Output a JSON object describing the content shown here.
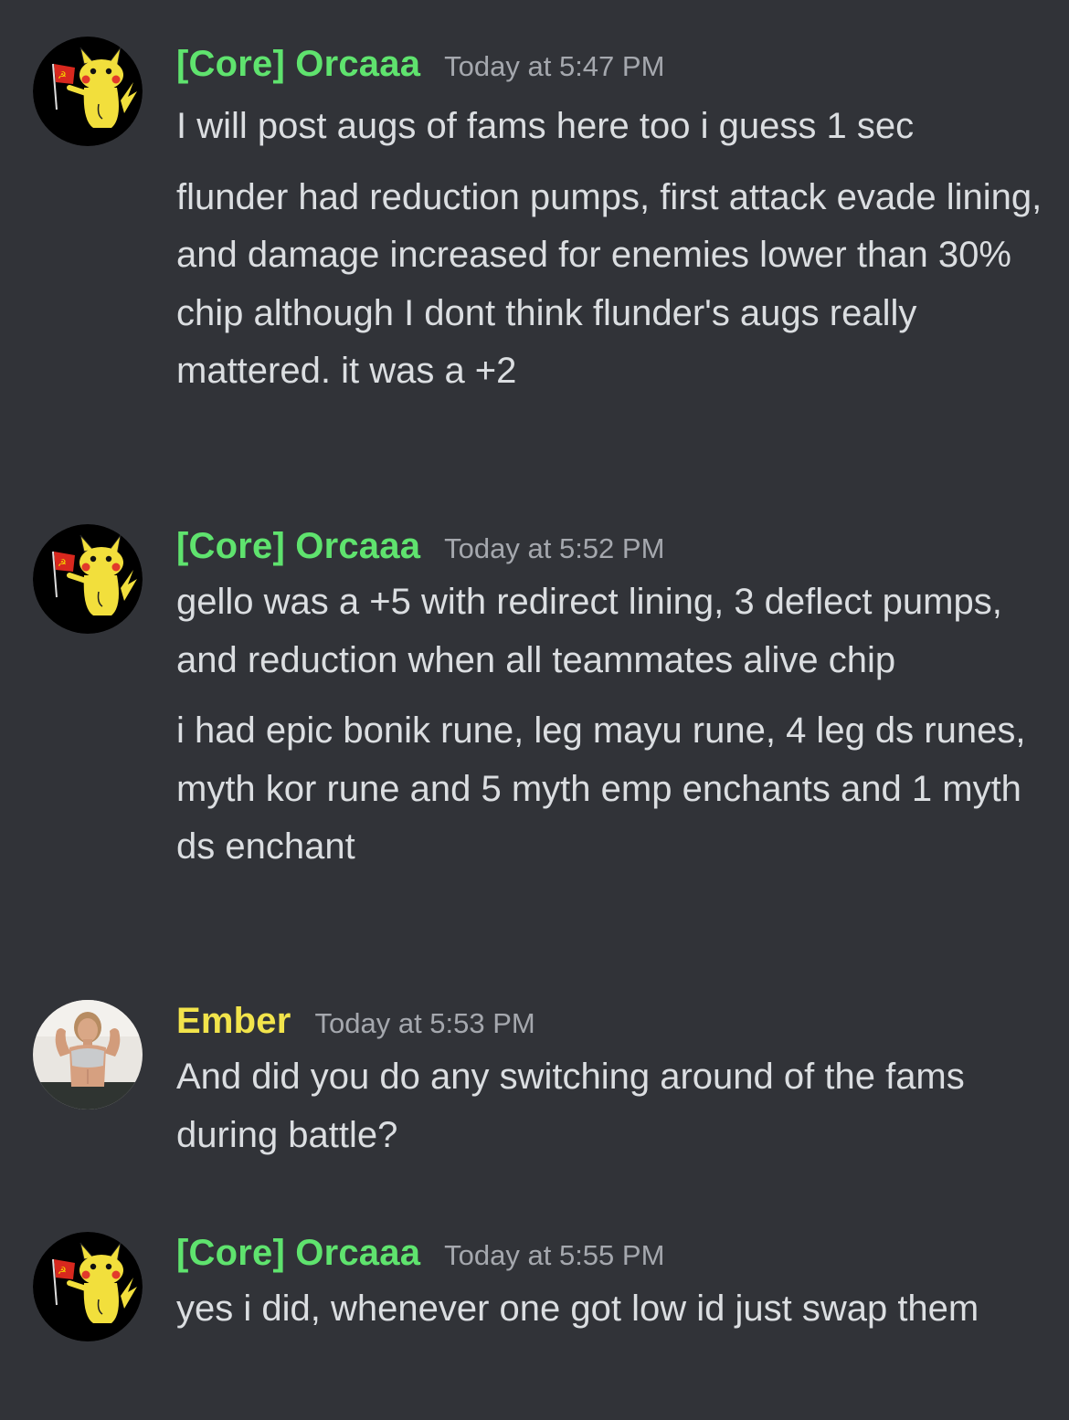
{
  "colors": {
    "background": "#313338",
    "text": "#dbdee1",
    "timestamp": "#a5a8ae",
    "username_core": "#5fe36e",
    "username_ember": "#f2e44b"
  },
  "messages": [
    {
      "author": "[Core] Orcaaa",
      "avatar_icon": "pikachu-flag-avatar-icon",
      "timestamp": "Today at 5:47 PM",
      "texts": [
        "I will post augs of fams here too i guess 1 sec",
        "flunder had reduction pumps, first attack evade lining, and damage increased for enemies lower than 30% chip although I dont think flunder's augs really mattered. it was a +2"
      ]
    },
    {
      "author": "[Core] Orcaaa",
      "avatar_icon": "pikachu-flag-avatar-icon",
      "timestamp": "Today at 5:52 PM",
      "texts": [
        "gello was a +5 with redirect lining, 3 deflect pumps, and reduction when all teammates alive chip",
        "i had epic bonik rune, leg mayu rune, 4 leg ds runes, myth kor rune and 5 myth emp enchants and 1 myth ds enchant"
      ]
    },
    {
      "author": "Ember",
      "avatar_icon": "user-photo-avatar-icon",
      "timestamp": "Today at 5:53 PM",
      "texts": [
        "And did you do any switching around of the fams during battle?"
      ]
    },
    {
      "author": "[Core] Orcaaa",
      "avatar_icon": "pikachu-flag-avatar-icon",
      "timestamp": "Today at 5:55 PM",
      "texts": [
        "yes i did, whenever one got low id just swap them"
      ]
    }
  ]
}
